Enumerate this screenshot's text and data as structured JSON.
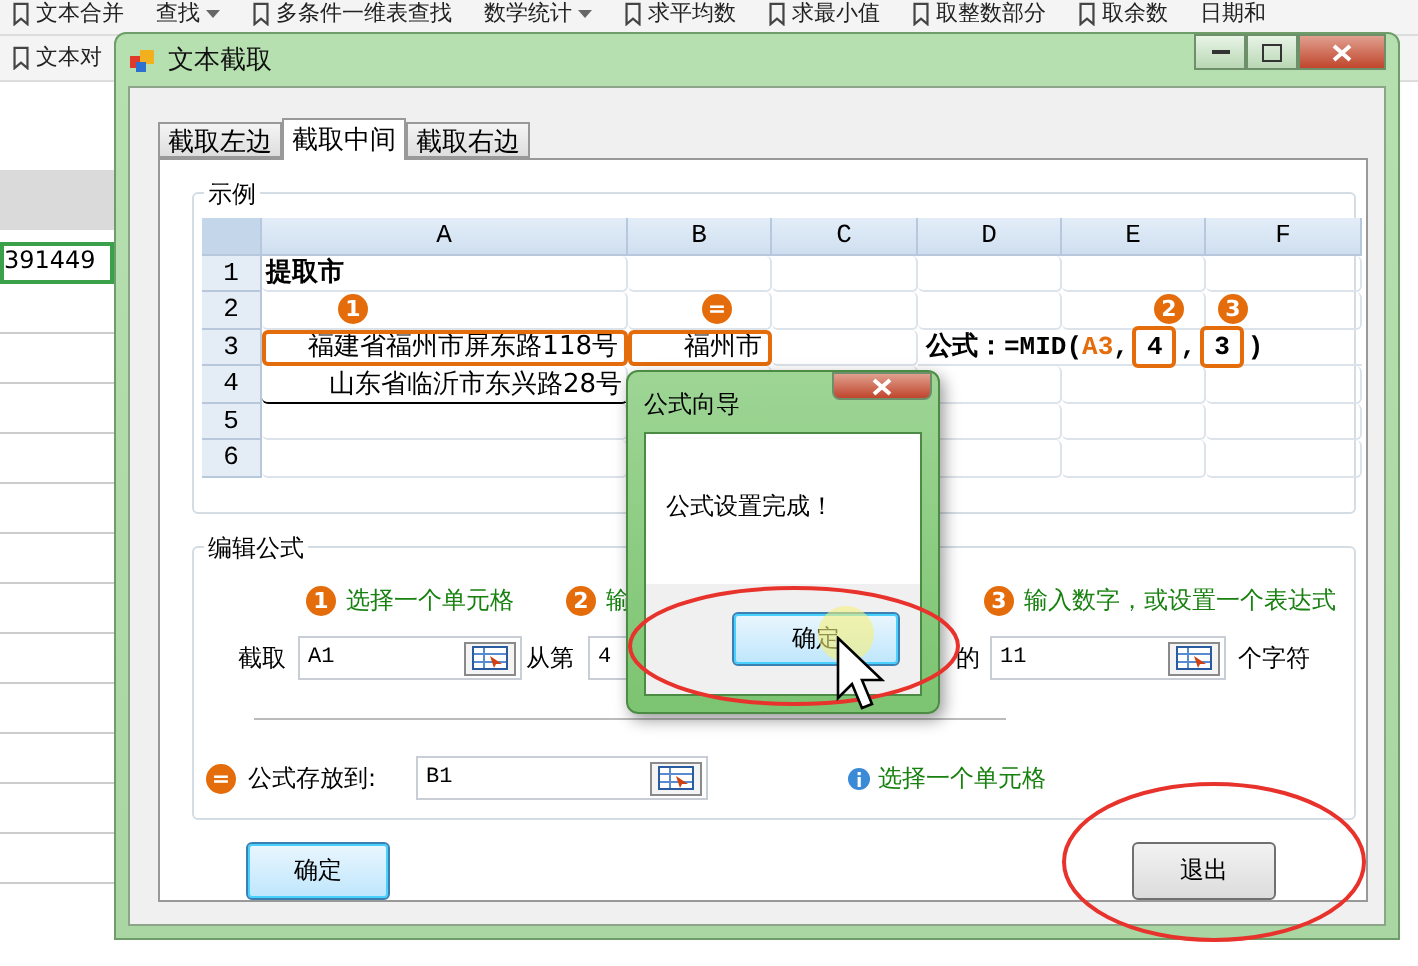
{
  "background": {
    "toolbar_row_1": [
      {
        "label": "文本合并",
        "kind": "button"
      },
      {
        "label": "查找",
        "kind": "menu"
      },
      {
        "label": "多条件一维表查找",
        "kind": "button"
      },
      {
        "label": "数学统计",
        "kind": "menu"
      },
      {
        "label": "求平均数",
        "kind": "button"
      },
      {
        "label": "求最小值",
        "kind": "button"
      },
      {
        "label": "取整数部分",
        "kind": "button"
      },
      {
        "label": "取余数",
        "kind": "button"
      },
      {
        "label": "日期和",
        "kind": "plain"
      }
    ],
    "toolbar_row_2": [
      {
        "label": "文本对",
        "kind": "button"
      }
    ],
    "cell_value": "391449"
  },
  "window": {
    "title": "文本截取"
  },
  "tabs": [
    {
      "label": "截取左边",
      "selected": false
    },
    {
      "label": "截取中间",
      "selected": true
    },
    {
      "label": "截取右边",
      "selected": false
    }
  ],
  "example": {
    "title": "示例",
    "columns": [
      "A",
      "B",
      "C",
      "D",
      "E",
      "F"
    ],
    "rows": [
      {
        "number": "1",
        "kind": "title",
        "a": "提取市"
      },
      {
        "number": "2",
        "kind": "empty"
      },
      {
        "number": "3",
        "kind": "marked",
        "a": "福建省福州市屏东路118号",
        "b": "福州市",
        "a_badge": "1",
        "b_badge": "=",
        "formula": [
          {
            "kind": "label",
            "text": "公式："
          },
          {
            "kind": "text",
            "text": "=MID("
          },
          {
            "kind": "ref",
            "text": "A3"
          },
          {
            "kind": "text",
            "text": ","
          },
          {
            "kind": "arg",
            "text": "4",
            "badge": "2"
          },
          {
            "kind": "text",
            "text": ","
          },
          {
            "kind": "arg",
            "text": "3",
            "badge": "3"
          },
          {
            "kind": "text",
            "text": ")"
          }
        ]
      },
      {
        "number": "4",
        "kind": "data",
        "a": "山东省临沂市东兴路28号"
      },
      {
        "number": "5",
        "kind": "empty"
      },
      {
        "number": "6",
        "kind": "empty"
      }
    ]
  },
  "edit": {
    "title": "编辑公式",
    "hints": [
      {
        "badge": "1",
        "text": "选择一个单元格"
      },
      {
        "badge": "2",
        "text": "输"
      },
      {
        "badge": "3",
        "text": "输入数字，或设置一个表达式"
      }
    ],
    "fields": [
      {
        "label": "截取",
        "value": "A1"
      },
      {
        "label": "从第",
        "value": "4"
      },
      {
        "label": "的",
        "value": "11"
      }
    ],
    "unit": "个字符",
    "output": {
      "badge": "=",
      "label": "公式存放到:",
      "value": "B1",
      "hint": "选择一个单元格"
    }
  },
  "buttons": [
    {
      "label": "确定",
      "default": true
    },
    {
      "label": "退出",
      "default": false
    }
  ],
  "dialog": {
    "title": "公式向导",
    "message": "公式设置完成！",
    "button": "确定"
  }
}
